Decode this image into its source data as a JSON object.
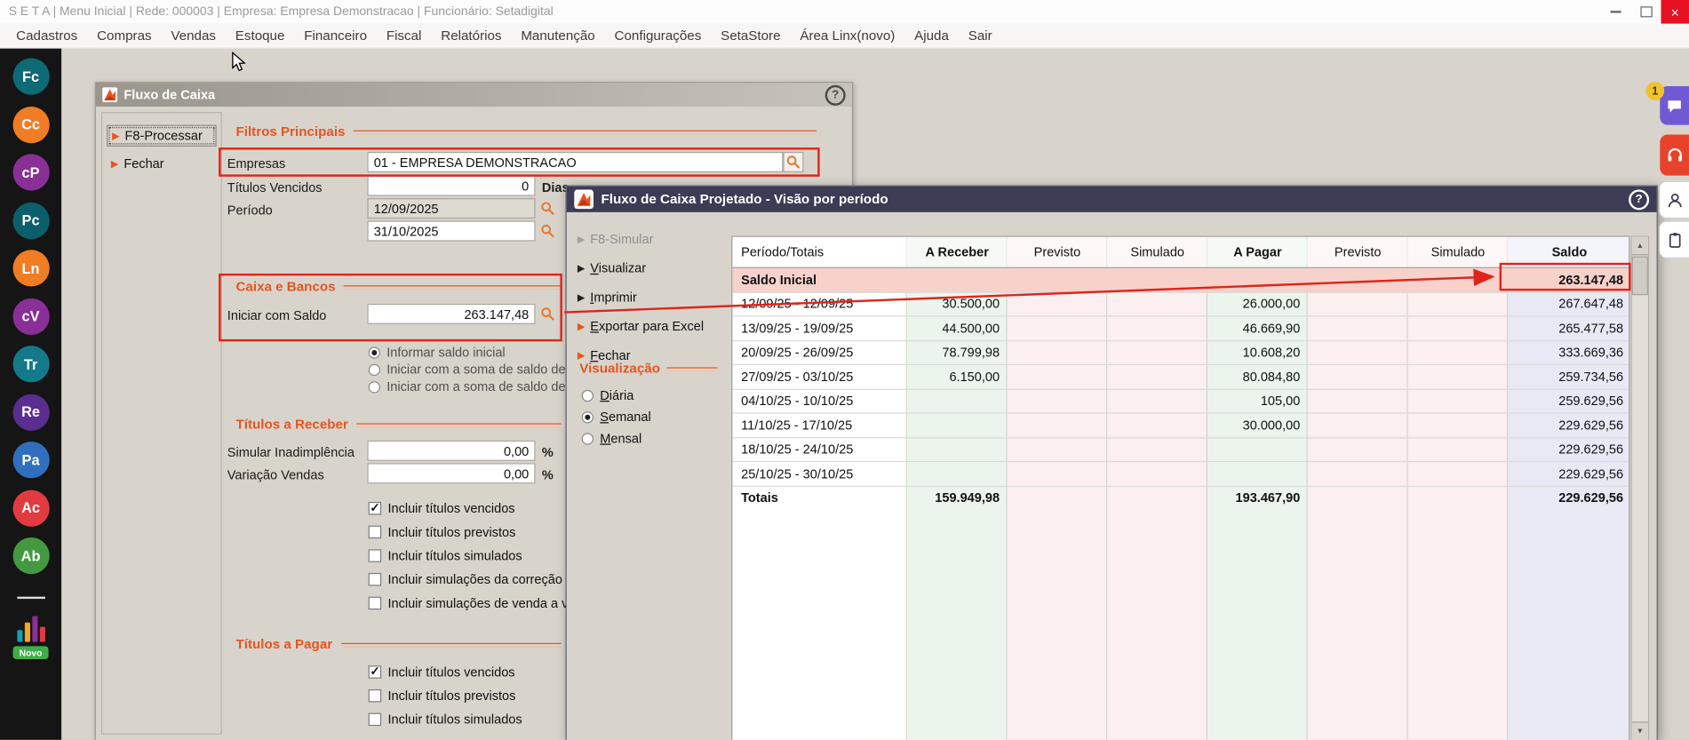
{
  "icons": {
    "action_arrow": "▶",
    "scroll_up": "▲",
    "scroll_down": "▼",
    "help": "?",
    "close": "×"
  },
  "titlebar": {
    "text": "S E T A | Menu Inicial | Rede: 000003 | Empresa: Empresa Demonstracao | Funcionário: Setadigital"
  },
  "menubar": {
    "items": [
      "Cadastros",
      "Compras",
      "Vendas",
      "Estoque",
      "Financeiro",
      "Fiscal",
      "Relatórios",
      "Manutenção",
      "Configurações",
      "SetaStore",
      "Área Linx(novo)",
      "Ajuda",
      "Sair"
    ]
  },
  "sidebar": {
    "items": [
      {
        "label": "Fc",
        "color": "#0e6a74"
      },
      {
        "label": "Cc",
        "color": "#f07d23"
      },
      {
        "label": "cP",
        "color": "#8a2f98"
      },
      {
        "label": "Pc",
        "color": "#0b5f6b"
      },
      {
        "label": "Ln",
        "color": "#f07d23"
      },
      {
        "label": "cV",
        "color": "#8a2f98"
      },
      {
        "label": "Tr",
        "color": "#13798b"
      },
      {
        "label": "Re",
        "color": "#5a2d91"
      },
      {
        "label": "Pa",
        "color": "#2f6fbd"
      },
      {
        "label": "Ac",
        "color": "#e23b3f"
      },
      {
        "label": "Ab",
        "color": "#43993f"
      }
    ],
    "novo_badge": "Novo"
  },
  "window1": {
    "title": "Fluxo de Caixa",
    "actions": [
      "F8-Processar",
      "Fechar"
    ],
    "sections": {
      "filtros": "Filtros Principais",
      "caixa": "Caixa e Bancos",
      "receber": "Títulos a Receber",
      "pagar": "Títulos a Pagar"
    },
    "fields": {
      "empresas_label": "Empresas",
      "empresas_value": "01 - EMPRESA DEMONSTRACAO",
      "vencidos_label": "Títulos Vencidos",
      "vencidos_value": "0",
      "vencidos_suffix": "Dias",
      "periodo_label": "Período",
      "periodo_de": "12/09/2025",
      "periodo_ate": "31/10/2025",
      "saldo_label": "Iniciar com Saldo",
      "saldo_value": "263.147,48",
      "inadimplencia_label": "Simular Inadimplência",
      "inadimplencia_value": "0,00",
      "variacao_label": "Variação Vendas",
      "variacao_value": "0,00",
      "percent": "%"
    },
    "saldo_radios": [
      {
        "label": "Informar saldo inicial",
        "checked": true
      },
      {
        "label": "Iniciar com a soma de saldo de",
        "checked": false
      },
      {
        "label": "Iniciar com a soma de saldo de",
        "checked": false
      }
    ],
    "receber_checks": [
      {
        "label": "Incluir títulos vencidos",
        "checked": true
      },
      {
        "label": "Incluir títulos previstos",
        "checked": false
      },
      {
        "label": "Incluir títulos simulados",
        "checked": false
      },
      {
        "label": "Incluir simulações da correção",
        "checked": false
      },
      {
        "label": "Incluir simulações de venda a v",
        "checked": false
      }
    ],
    "pagar_checks": [
      {
        "label": "Incluir títulos vencidos",
        "checked": true
      },
      {
        "label": "Incluir títulos previstos",
        "checked": false
      },
      {
        "label": "Incluir títulos simulados",
        "checked": false
      }
    ]
  },
  "window2": {
    "title": "Fluxo de Caixa Projetado - Visão por período",
    "actions": [
      {
        "label": "F8-Simular",
        "style": "disabled"
      },
      {
        "label": "Visualizar",
        "style": "dark",
        "u": "V"
      },
      {
        "label": "Imprimir",
        "style": "dark",
        "u": "I"
      },
      {
        "label": "Exportar para Excel",
        "style": "orange",
        "u": "E"
      },
      {
        "label": "Fechar",
        "style": "orange",
        "u": "F"
      }
    ],
    "visualizacao": {
      "title": "Visualização",
      "options": [
        {
          "label": "Diária",
          "checked": false,
          "u": "D"
        },
        {
          "label": "Semanal",
          "checked": true,
          "u": "S"
        },
        {
          "label": "Mensal",
          "checked": false,
          "u": "M"
        }
      ]
    },
    "table": {
      "headers": [
        "Período/Totais",
        "A Receber",
        "Previsto",
        "Simulado",
        "A Pagar",
        "Previsto",
        "Simulado",
        "Saldo"
      ],
      "rows": [
        {
          "type": "saldo-inicial",
          "cells": [
            "Saldo Inicial",
            "",
            "",
            "",
            "",
            "",
            "",
            "263.147,48"
          ]
        },
        {
          "type": "data",
          "cells": [
            "12/09/25 - 12/09/25",
            "30.500,00",
            "",
            "",
            "26.000,00",
            "",
            "",
            "267.647,48"
          ]
        },
        {
          "type": "data",
          "cells": [
            "13/09/25 - 19/09/25",
            "44.500,00",
            "",
            "",
            "46.669,90",
            "",
            "",
            "265.477,58"
          ]
        },
        {
          "type": "data",
          "cells": [
            "20/09/25 - 26/09/25",
            "78.799,98",
            "",
            "",
            "10.608,20",
            "",
            "",
            "333.669,36"
          ]
        },
        {
          "type": "data",
          "cells": [
            "27/09/25 - 03/10/25",
            "6.150,00",
            "",
            "",
            "80.084,80",
            "",
            "",
            "259.734,56"
          ]
        },
        {
          "type": "data",
          "cells": [
            "04/10/25 - 10/10/25",
            "",
            "",
            "",
            "105,00",
            "",
            "",
            "259.629,56"
          ]
        },
        {
          "type": "data",
          "cells": [
            "11/10/25 - 17/10/25",
            "",
            "",
            "",
            "30.000,00",
            "",
            "",
            "229.629,56"
          ]
        },
        {
          "type": "data",
          "cells": [
            "18/10/25 - 24/10/25",
            "",
            "",
            "",
            "",
            "",
            "",
            "229.629,56"
          ]
        },
        {
          "type": "data",
          "cells": [
            "25/10/25 - 30/10/25",
            "",
            "",
            "",
            "",
            "",
            "",
            "229.629,56"
          ]
        },
        {
          "type": "totais",
          "cells": [
            "Totais",
            "159.949,98",
            "",
            "",
            "193.467,90",
            "",
            "",
            "229.629,56"
          ]
        }
      ]
    }
  },
  "floating": {
    "badge": "1"
  }
}
